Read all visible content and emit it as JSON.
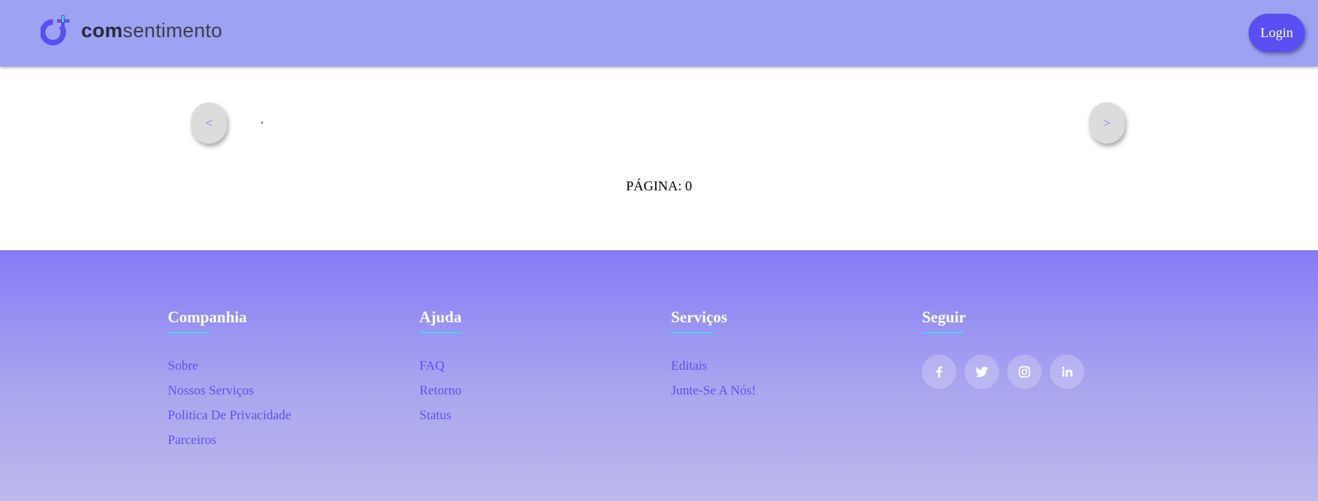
{
  "header": {
    "logo_text_bold": "com",
    "logo_text_rest": "sentimento",
    "login_label": "Login"
  },
  "carousel": {
    "prev_label": "<",
    "next_label": ">",
    "page_indicator": "PÁGINA: 0"
  },
  "footer": {
    "columns": [
      {
        "title": "Companhia",
        "links": [
          "Sobre",
          "Nossos Serviços",
          "Politica De Privacidade",
          "Parceiros"
        ]
      },
      {
        "title": "Ajuda",
        "links": [
          "FAQ",
          "Retorno",
          "Status"
        ]
      },
      {
        "title": "Serviços",
        "links": [
          "Editais",
          "Junte-Se A Nós!"
        ]
      },
      {
        "title": "Seguir",
        "socials": [
          "facebook-icon",
          "twitter-icon",
          "instagram-icon",
          "linkedin-icon"
        ]
      }
    ]
  },
  "colors": {
    "header_bg": "#9ea2f2",
    "accent": "#5b4ef2",
    "link": "#5b52ee",
    "underline": "#4fd1e6"
  }
}
